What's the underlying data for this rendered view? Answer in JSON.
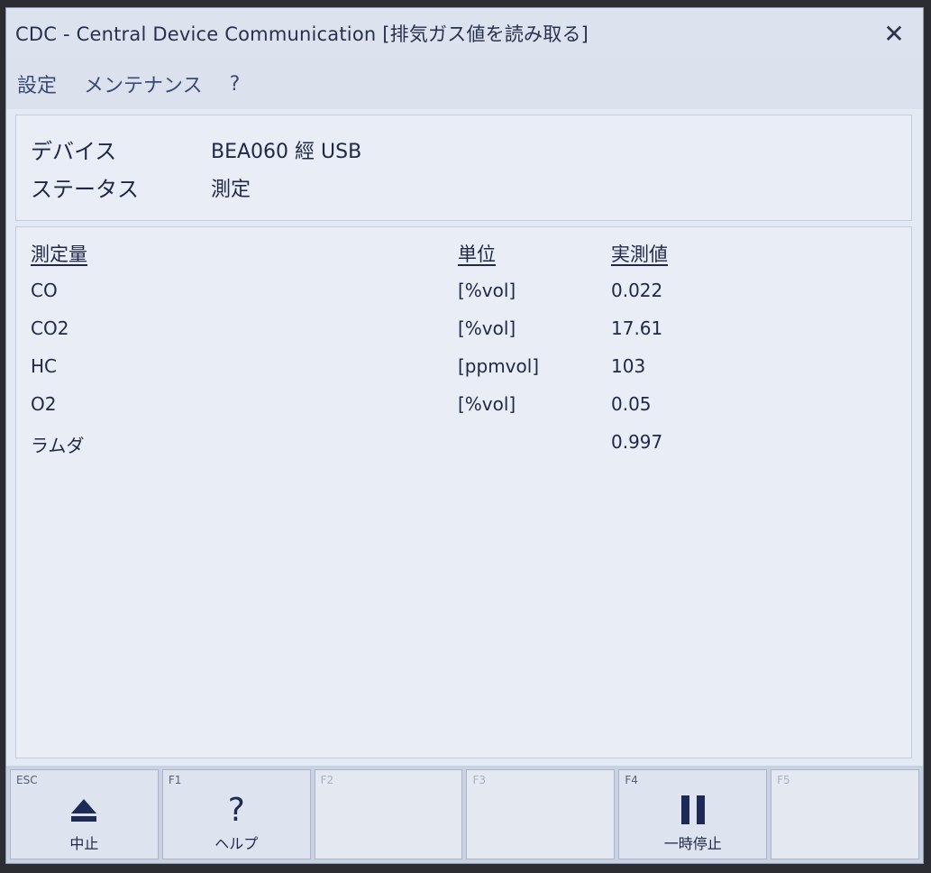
{
  "window": {
    "title": "CDC - Central Device Communication [排気ガス値を読み取る]",
    "close_glyph": "✕"
  },
  "menu": {
    "items": [
      "設定",
      "メンテナンス",
      "?"
    ]
  },
  "device_info": {
    "device_label": "デバイス",
    "device_value": "BEA060 經 USB",
    "status_label": "ステータス",
    "status_value": "測定"
  },
  "table": {
    "headers": {
      "name": "測定量",
      "unit": "単位",
      "value": "実測値"
    },
    "rows": [
      {
        "name": "CO",
        "unit": "[%vol]",
        "value": "0.022"
      },
      {
        "name": "CO2",
        "unit": "[%vol]",
        "value": "17.61"
      },
      {
        "name": "HC",
        "unit": "[ppmvol]",
        "value": "103"
      },
      {
        "name": "O2",
        "unit": "[%vol]",
        "value": "0.05"
      },
      {
        "name": "ラムダ",
        "unit": "",
        "value": "0.997"
      }
    ]
  },
  "fkeys": [
    {
      "key": "ESC",
      "label": "中止",
      "icon": "eject-icon",
      "enabled": true
    },
    {
      "key": "F1",
      "label": "ヘルプ",
      "icon": "help-icon",
      "enabled": true
    },
    {
      "key": "F2",
      "label": "",
      "icon": "",
      "enabled": false
    },
    {
      "key": "F3",
      "label": "",
      "icon": "",
      "enabled": false
    },
    {
      "key": "F4",
      "label": "一時停止",
      "icon": "pause-icon",
      "enabled": true
    },
    {
      "key": "F5",
      "label": "",
      "icon": "",
      "enabled": false
    }
  ],
  "colors": {
    "window_bg": "#e4eaf3",
    "icon": "#1c2a55"
  }
}
